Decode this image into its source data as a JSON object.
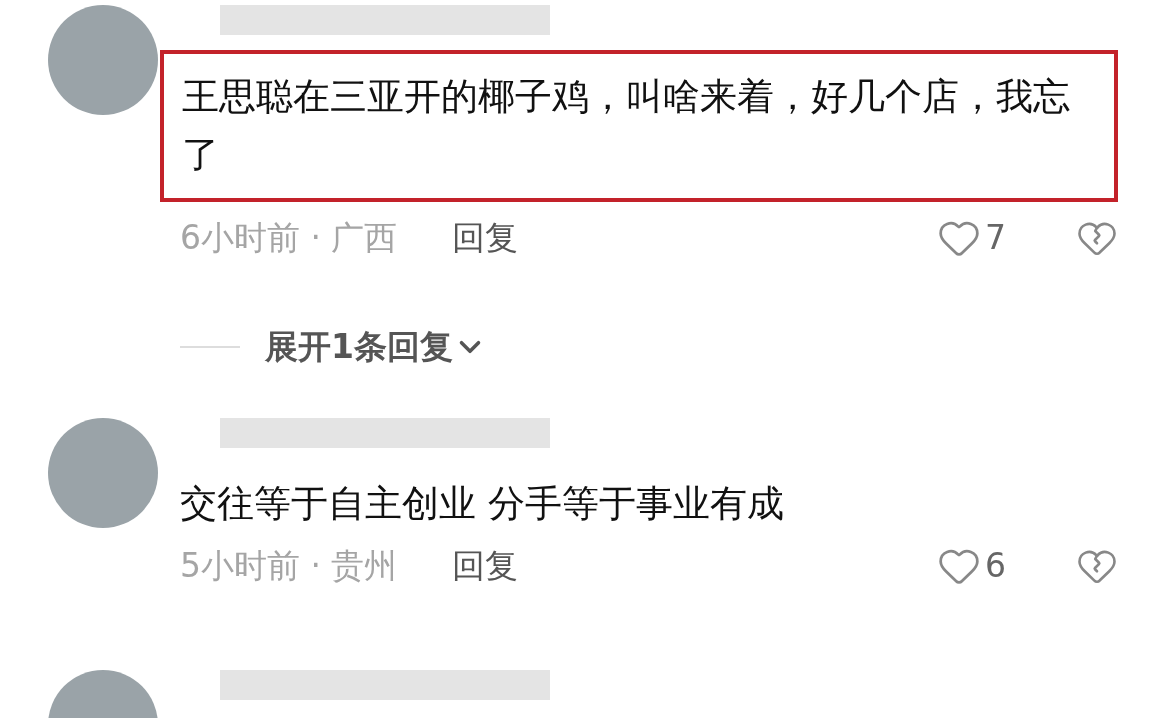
{
  "comments": [
    {
      "kind": "full",
      "text": "王思聪在三亚开的椰子鸡，叫啥来着，好几个店，我忘了",
      "highlighted": true,
      "time": "6小时前 · 广西",
      "reply_label": "回复",
      "likes": "7",
      "expand_replies": "展开1条回复"
    },
    {
      "kind": "full",
      "text": "交往等于自主创业 分手等于事业有成",
      "highlighted": false,
      "time": "5小时前 · 贵州",
      "reply_label": "回复",
      "likes": "6"
    },
    {
      "kind": "cut_off"
    }
  ]
}
